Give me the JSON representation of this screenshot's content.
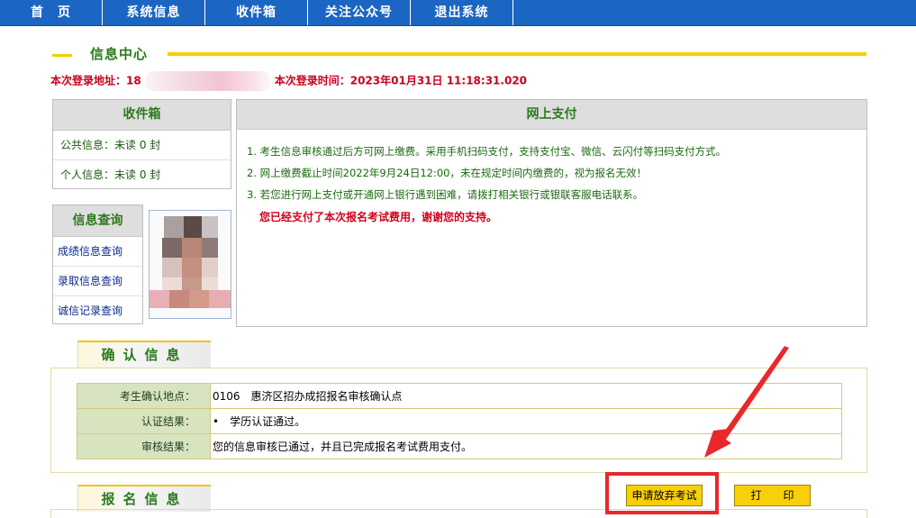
{
  "nav": {
    "items": [
      "首　页",
      "系统信息",
      "收件箱",
      "关注公众号",
      "退出系统"
    ]
  },
  "info_center": {
    "title": "信息中心",
    "login_address_label": "本次登录地址：",
    "login_address_prefix": "18",
    "login_time_label": "本次登录时间：",
    "login_time_value": "2023年01月31日 11:18:31.020"
  },
  "inbox": {
    "title": "收件箱",
    "public_label": "公共信息：",
    "public_value": "未读 0 封",
    "personal_label": "个人信息：",
    "personal_value": "未读 0 封"
  },
  "query": {
    "title": "信息查询",
    "links": [
      "成绩信息查询",
      "录取信息查询",
      "诚信记录查询"
    ]
  },
  "payment": {
    "title": "网上支付",
    "items": [
      "1. 考生信息审核通过后方可网上缴费。采用手机扫码支付，支持支付宝、微信、云闪付等扫码支付方式。",
      "2. 网上缴费截止时间2022年9月24日12:00，未在规定时间内缴费的，视为报名无效！",
      "3. 若您进行网上支付或开通网上银行遇到困难，请拨打相关银行或银联客服电话联系。"
    ],
    "paid_notice": "您已经支付了本次报名考试费用，谢谢您的支持。"
  },
  "confirm": {
    "title": "确认信息",
    "rows": [
      {
        "label": "考生确认地点：",
        "value": "0106　惠济区招办成招报名审核确认点"
      },
      {
        "label": "认证结果：",
        "value": "•　学历认证通过。"
      },
      {
        "label": "审核结果：",
        "value": "您的信息审核已通过，并且已完成报名考试费用支付。"
      }
    ]
  },
  "registration": {
    "title": "报名信息"
  },
  "buttons": {
    "abandon": "申请放弃考试",
    "print": "打　　印"
  },
  "colors": {
    "nav_bg": "#1a66c2",
    "accent_yellow": "#f2d000",
    "title_green": "#2c7a1c",
    "alert_red": "#d0001b",
    "highlight_red": "#e8282b"
  }
}
